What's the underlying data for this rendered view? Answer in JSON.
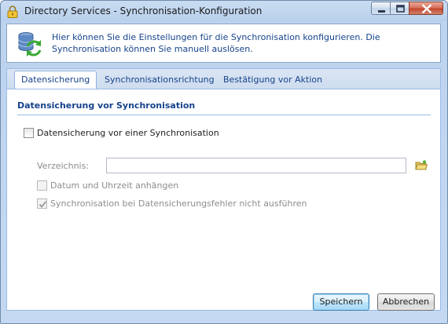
{
  "window": {
    "title": "Directory Services - Synchronisation-Konfiguration",
    "icon": "lock-icon"
  },
  "info": {
    "icon": "database-sync-icon",
    "text": "Hier können Sie die Einstellungen für die Synchronisation konfigurieren. Die Synchronisation können Sie manuell auslösen."
  },
  "tabs": [
    {
      "label": "Datensicherung",
      "active": true
    },
    {
      "label": "Synchronisationsrichtung",
      "active": false
    },
    {
      "label": "Bestätigung vor Aktion",
      "active": false
    }
  ],
  "backup": {
    "section_title": "Datensicherung vor Synchronisation",
    "enable_label": "Datensicherung vor einer Synchronisation",
    "enable_checked": false,
    "directory_label": "Verzeichnis:",
    "directory_value": "",
    "directory_placeholder": "",
    "browse_icon": "folder-icon",
    "append_datetime_label": "Datum und Uhrzeit anhängen",
    "append_datetime_checked": false,
    "skip_on_error_label": "Synchronisation bei Datensicherungsfehler nicht ausführen",
    "skip_on_error_checked": true
  },
  "buttons": {
    "save": "Speichern",
    "cancel": "Abbrechen"
  },
  "colors": {
    "accent_text": "#15428b",
    "frame": "#c4d9f1",
    "disabled_text": "#8c8c8c"
  }
}
